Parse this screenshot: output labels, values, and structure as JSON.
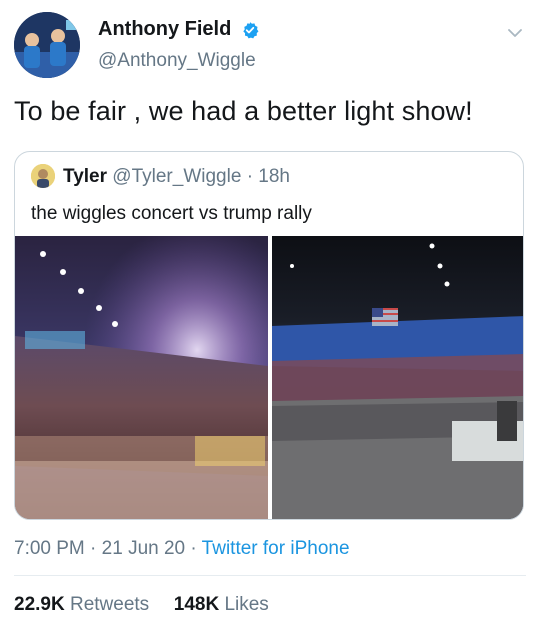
{
  "tweet": {
    "author": {
      "display_name": "Anthony Field",
      "handle": "@Anthony_Wiggle",
      "verified": true
    },
    "text": "To be fair , we had a better light show!",
    "timestamp": "7:00 PM",
    "date": "21 Jun 20",
    "source": "Twitter for iPhone",
    "separator": "·",
    "stats": {
      "retweets_count": "22.9K",
      "retweets_label": "Retweets",
      "likes_count": "148K",
      "likes_label": "Likes"
    }
  },
  "quoted_tweet": {
    "display_name": "Tyler",
    "handle": "@Tyler_Wiggle",
    "age": "18h",
    "separator": "·",
    "text": "the wiggles concert vs trump rally"
  },
  "colors": {
    "link": "#1b95e0",
    "secondary_text": "#657786",
    "verified": "#1da1f2",
    "border": "#ccd6dd"
  },
  "icons": {
    "verified": "verified-badge-icon",
    "menu": "chevron-down-icon"
  }
}
